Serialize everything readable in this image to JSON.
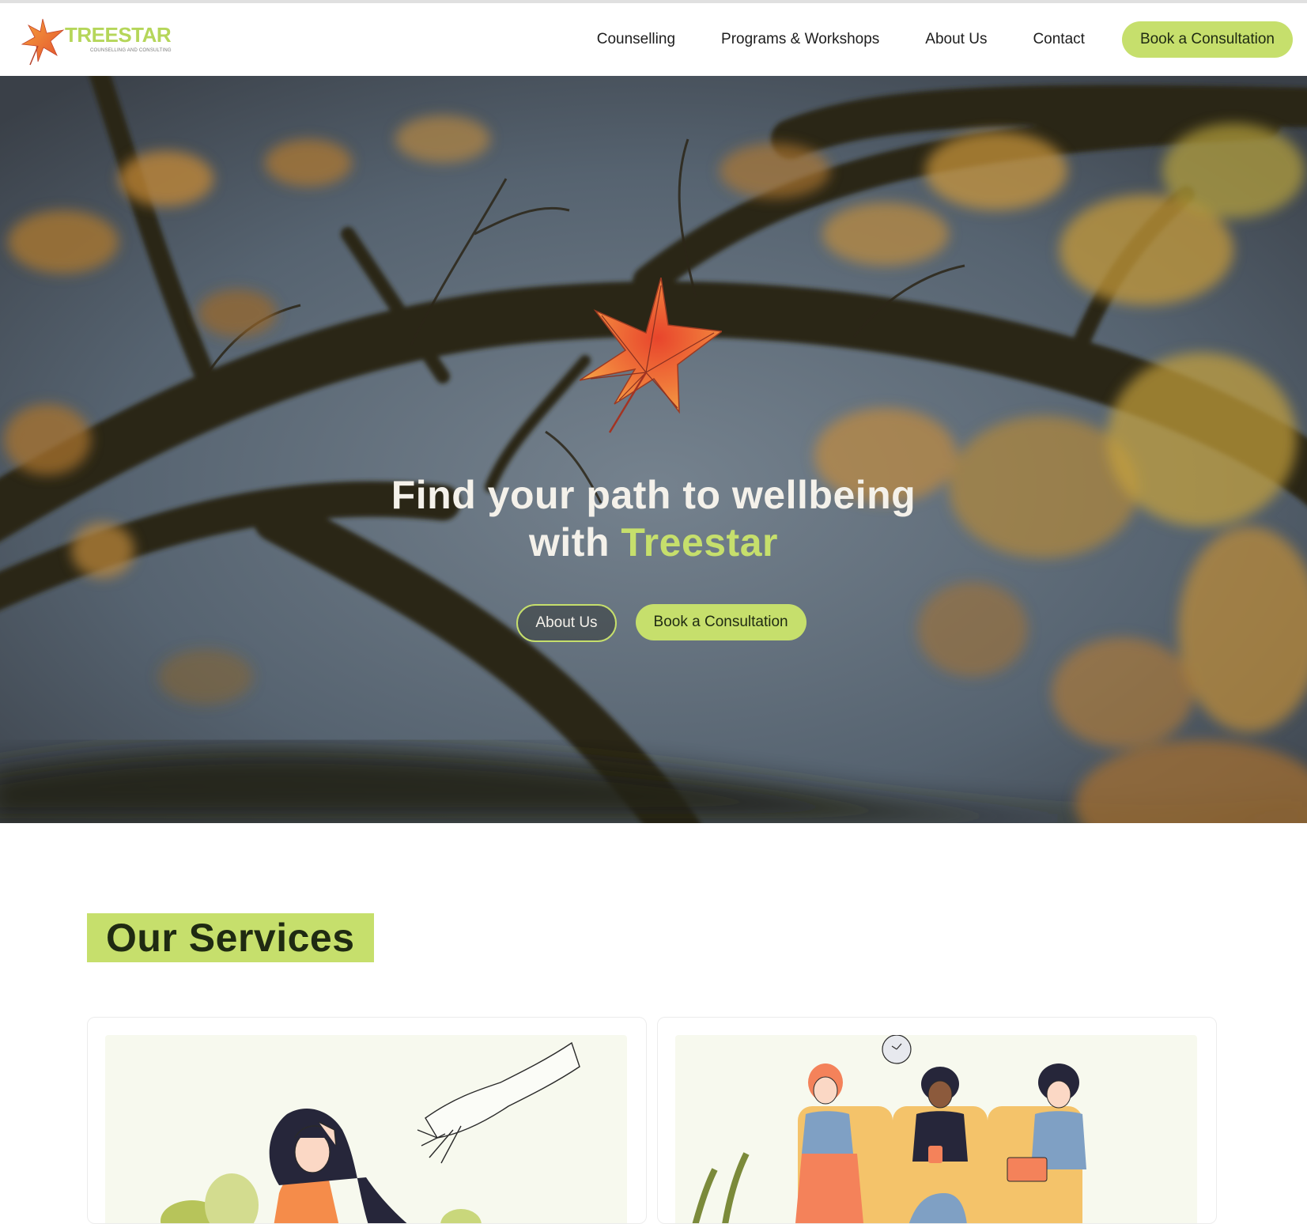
{
  "brand": {
    "name": "TREESTAR",
    "tagline": "COUNSELLING AND CONSULTING",
    "accent_color": "#c6df6c",
    "logo_icon": "maple-leaf-icon"
  },
  "nav": {
    "items": [
      {
        "label": "Counselling"
      },
      {
        "label": "Programs & Workshops"
      },
      {
        "label": "About Us"
      },
      {
        "label": "Contact"
      }
    ],
    "cta_label": "Book a Consultation"
  },
  "hero": {
    "title_line1": "Find your path to wellbeing",
    "title_line2_prefix": "with ",
    "title_line2_accent": "Treestar",
    "primary_button": "About Us",
    "secondary_button": "Book a Consultation",
    "background": "autumn-tree-branches-photo",
    "emblem_icon": "maple-leaf-icon"
  },
  "services": {
    "heading": "Our Services",
    "cards": [
      {
        "illustration": "person-in-distress-with-helping-hand"
      },
      {
        "illustration": "group-of-people-on-sofa"
      }
    ]
  }
}
